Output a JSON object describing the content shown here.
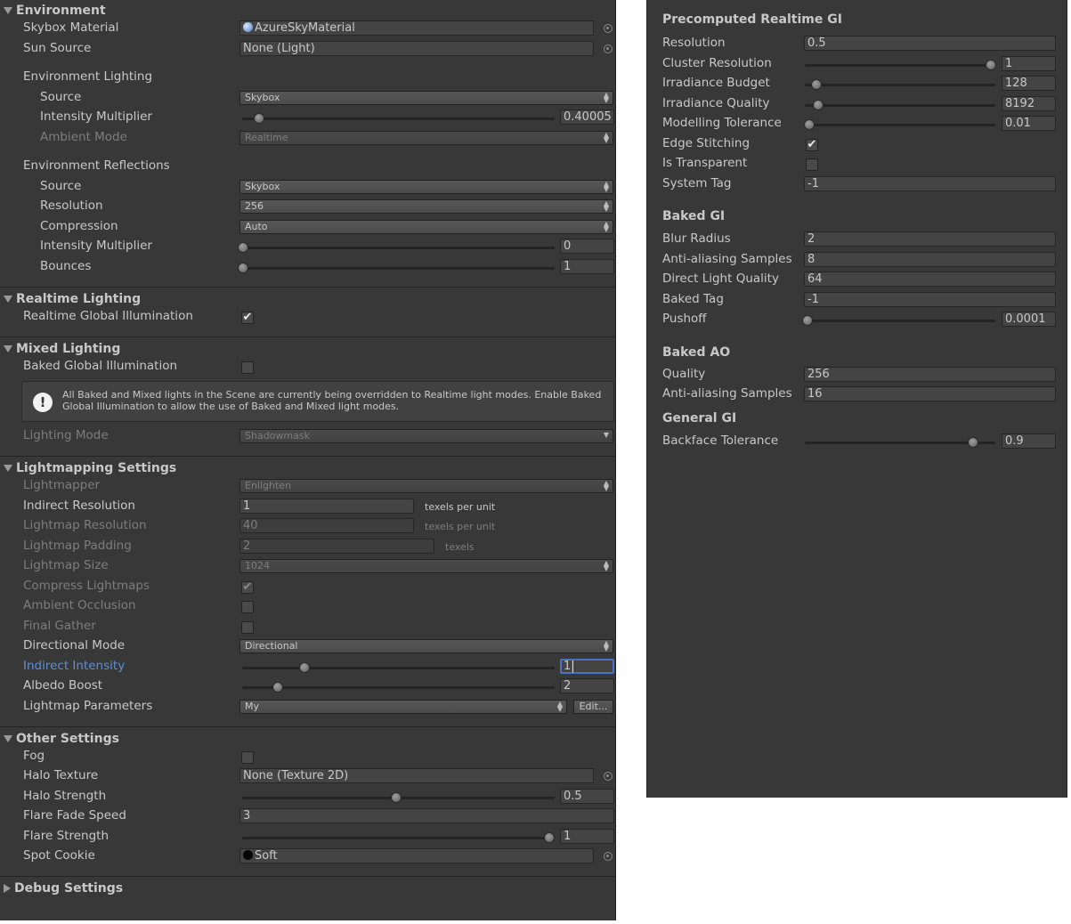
{
  "left": {
    "environment": {
      "header": "Environment",
      "skybox_material": {
        "label": "Skybox Material",
        "value": "AzureSkyMaterial"
      },
      "sun_source": {
        "label": "Sun Source",
        "value": "None (Light)"
      },
      "env_lighting": {
        "title": "Environment Lighting",
        "source": {
          "label": "Source",
          "value": "Skybox"
        },
        "intensity": {
          "label": "Intensity Multiplier",
          "value": "0.40005",
          "slider": 0.054
        },
        "ambient_mode": {
          "label": "Ambient Mode",
          "value": "Realtime"
        }
      },
      "env_reflections": {
        "title": "Environment Reflections",
        "source": {
          "label": "Source",
          "value": "Skybox"
        },
        "resolution": {
          "label": "Resolution",
          "value": "256"
        },
        "compression": {
          "label": "Compression",
          "value": "Auto"
        },
        "intensity": {
          "label": "Intensity Multiplier",
          "value": "0",
          "slider": 0
        },
        "bounces": {
          "label": "Bounces",
          "value": "1",
          "slider": 0
        }
      }
    },
    "realtime_lighting": {
      "header": "Realtime Lighting",
      "rtgi": {
        "label": "Realtime Global Illumination",
        "checked": true
      }
    },
    "mixed_lighting": {
      "header": "Mixed Lighting",
      "bakedgi": {
        "label": "Baked Global Illumination",
        "checked": false
      },
      "help_text": "All Baked and Mixed lights in the Scene are currently being overridden to Realtime light modes. Enable Baked Global Illumination to allow the use of Baked and Mixed light modes.",
      "help_icon": "exclamation-icon",
      "lighting_mode": {
        "label": "Lighting Mode",
        "value": "Shadowmask"
      }
    },
    "lightmapping": {
      "header": "Lightmapping Settings",
      "lightmapper": {
        "label": "Lightmapper",
        "value": "Enlighten"
      },
      "indirect_resolution": {
        "label": "Indirect Resolution",
        "value": "1",
        "unit": "texels per unit"
      },
      "lightmap_resolution": {
        "label": "Lightmap Resolution",
        "value": "40",
        "unit": "texels per unit"
      },
      "lightmap_padding": {
        "label": "Lightmap Padding",
        "value": "2",
        "unit": "texels"
      },
      "lightmap_size": {
        "label": "Lightmap Size",
        "value": "1024"
      },
      "compress": {
        "label": "Compress Lightmaps",
        "checked": true
      },
      "ao": {
        "label": "Ambient Occlusion",
        "checked": false
      },
      "final_gather": {
        "label": "Final Gather",
        "checked": false
      },
      "directional_mode": {
        "label": "Directional Mode",
        "value": "Directional"
      },
      "indirect_intensity": {
        "label": "Indirect Intensity",
        "value": "1",
        "slider": 0.2
      },
      "albedo_boost": {
        "label": "Albedo Boost",
        "value": "2",
        "slider": 0.11
      },
      "params": {
        "label": "Lightmap Parameters",
        "value": "My",
        "edit": "Edit..."
      }
    },
    "other": {
      "header": "Other Settings",
      "fog": {
        "label": "Fog",
        "checked": false
      },
      "halo_texture": {
        "label": "Halo Texture",
        "value": "None (Texture 2D)"
      },
      "halo_strength": {
        "label": "Halo Strength",
        "value": "0.5",
        "slider": 0.5
      },
      "flare_fade": {
        "label": "Flare Fade Speed",
        "value": "3"
      },
      "flare_strength": {
        "label": "Flare Strength",
        "value": "1",
        "slider": 1.0
      },
      "spot_cookie": {
        "label": "Spot Cookie",
        "value": "Soft"
      }
    },
    "debug": {
      "header": "Debug Settings"
    }
  },
  "right": {
    "precomputed": {
      "header": "Precomputed Realtime GI",
      "resolution": {
        "label": "Resolution",
        "value": "0.5"
      },
      "cluster_resolution": {
        "label": "Cluster Resolution",
        "value": "1",
        "slider": 1.0
      },
      "irradiance_budget": {
        "label": "Irradiance Budget",
        "value": "128",
        "slider": 0.06
      },
      "irradiance_quality": {
        "label": "Irradiance Quality",
        "value": "8192",
        "slider": 0.07
      },
      "modelling_tolerance": {
        "label": "Modelling Tolerance",
        "value": "0.01",
        "slider": 0
      },
      "edge_stitching": {
        "label": "Edge Stitching",
        "checked": true
      },
      "is_transparent": {
        "label": "Is Transparent",
        "checked": false
      },
      "system_tag": {
        "label": "System Tag",
        "value": "-1"
      }
    },
    "baked_gi": {
      "header": "Baked GI",
      "blur_radius": {
        "label": "Blur Radius",
        "value": "2"
      },
      "aa_samples": {
        "label": "Anti-aliasing Samples",
        "value": "8"
      },
      "direct_light_quality": {
        "label": "Direct Light Quality",
        "value": "64"
      },
      "baked_tag": {
        "label": "Baked Tag",
        "value": "-1"
      },
      "pushoff": {
        "label": "Pushoff",
        "value": "0.0001",
        "slider": 0
      }
    },
    "baked_ao": {
      "header": "Baked AO",
      "quality": {
        "label": "Quality",
        "value": "256"
      },
      "aa_samples": {
        "label": "Anti-aliasing Samples",
        "value": "16"
      }
    },
    "general_gi": {
      "header": "General GI",
      "backface_tolerance": {
        "label": "Backface Tolerance",
        "value": "0.9",
        "slider": 0.9
      }
    }
  },
  "colors": {
    "panel_bg": "#383838",
    "text": "#c8c8c8",
    "dim_text": "#7d7d7d",
    "active_label": "#5b8fd9",
    "focus_border": "#4a72c4"
  }
}
